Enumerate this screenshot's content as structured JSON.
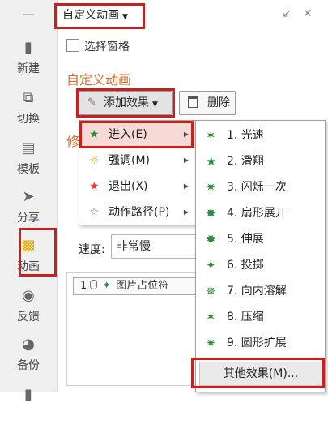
{
  "sidebar": {
    "items": [
      {
        "icon": "new-doc-icon",
        "label": "新建"
      },
      {
        "icon": "switch-icon",
        "label": "切换"
      },
      {
        "icon": "template-icon",
        "label": "模板"
      },
      {
        "icon": "share-icon",
        "label": "分享"
      },
      {
        "icon": "animation-icon",
        "label": "动画",
        "active": true
      },
      {
        "icon": "feedback-icon",
        "label": "反馈"
      },
      {
        "icon": "backup-icon",
        "label": "备份"
      }
    ]
  },
  "panel": {
    "title": "自定义动画",
    "selection_pane": "选择窗格",
    "section_title": "自定义动画",
    "add_effect": "添加效果",
    "delete": "删除",
    "modify_partial": "修",
    "speed_label": "速度:",
    "speed_value": "非常慢",
    "list_item": {
      "number": "1",
      "text": "图片占位符"
    }
  },
  "main_menu": {
    "items": [
      {
        "label": "进入(E)",
        "icon": "enter-star-icon",
        "color": "#2e8b3e"
      },
      {
        "label": "强调(M)",
        "icon": "emphasis-sun-icon",
        "color": "#e0a500"
      },
      {
        "label": "退出(X)",
        "icon": "exit-star-icon",
        "color": "#d9463b"
      },
      {
        "label": "动作路径(P)",
        "icon": "motion-path-star-icon",
        "color": "#3b6fc4"
      }
    ]
  },
  "sub_menu": {
    "items": [
      "1. 光速",
      "2. 滑翔",
      "3. 闪烁一次",
      "4. 扇形展开",
      "5. 伸展",
      "6. 投掷",
      "7. 向内溶解",
      "8. 压缩",
      "9. 圆形扩展"
    ],
    "more": "其他效果(M)..."
  },
  "colors": {
    "highlight_box": "#c9201d",
    "section_title": "#d56f2b",
    "menu_hover": "#f7d9d6"
  }
}
